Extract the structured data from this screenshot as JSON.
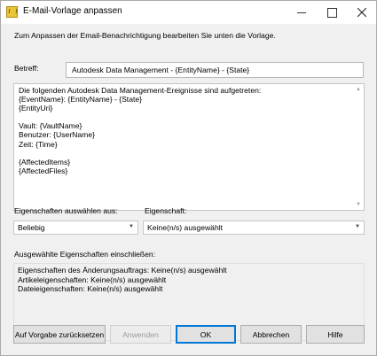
{
  "window": {
    "title": "E-Mail-Vorlage anpassen",
    "controls": {
      "minimize": "minimize-icon",
      "maximize": "maximize-icon",
      "close": "close-icon"
    }
  },
  "intro": "Zum Anpassen der Email-Benachrichtigung bearbeiten Sie unten die Vorlage.",
  "subject": {
    "label": "Betreff:",
    "value": "Autodesk Data Management - {EntityName} - {State}"
  },
  "body": {
    "lines": [
      "Die folgenden Autodesk Data Management-Ereignisse sind aufgetreten:",
      "{EventName}: {EntityName} - {State}",
      "{EntityUri}",
      "",
      "Vault: {VaultName}",
      "Benutzer: {UserName}",
      "Zeit: {Time}",
      "",
      "{AffectedItems}",
      "{AffectedFiles}"
    ]
  },
  "properties": {
    "select_label": "Eigenschaften auswählen aus:",
    "select_value": "Beliebig",
    "property_label": "Eigenschaft:",
    "property_value": "Keine(n/s) ausgewählt"
  },
  "include": {
    "label": "Ausgewählte Eigenschaften einschließen:",
    "lines": [
      "Eigenschaften des Änderungsauftrags: Keine(n/s) ausgewählt",
      "Artikeleigenschaften: Keine(n/s) ausgewählt",
      "Dateieigenschaften: Keine(n/s) ausgewählt"
    ]
  },
  "buttons": {
    "reset": "Auf Vorgabe zurücksetzen",
    "apply": "Anwenden",
    "ok": "OK",
    "cancel": "Abbrechen",
    "help": "Hilfe"
  },
  "colors": {
    "accent": "#0078d7",
    "dialog_bg": "#f0f0f0",
    "disabled_text": "#9a9a9a"
  }
}
